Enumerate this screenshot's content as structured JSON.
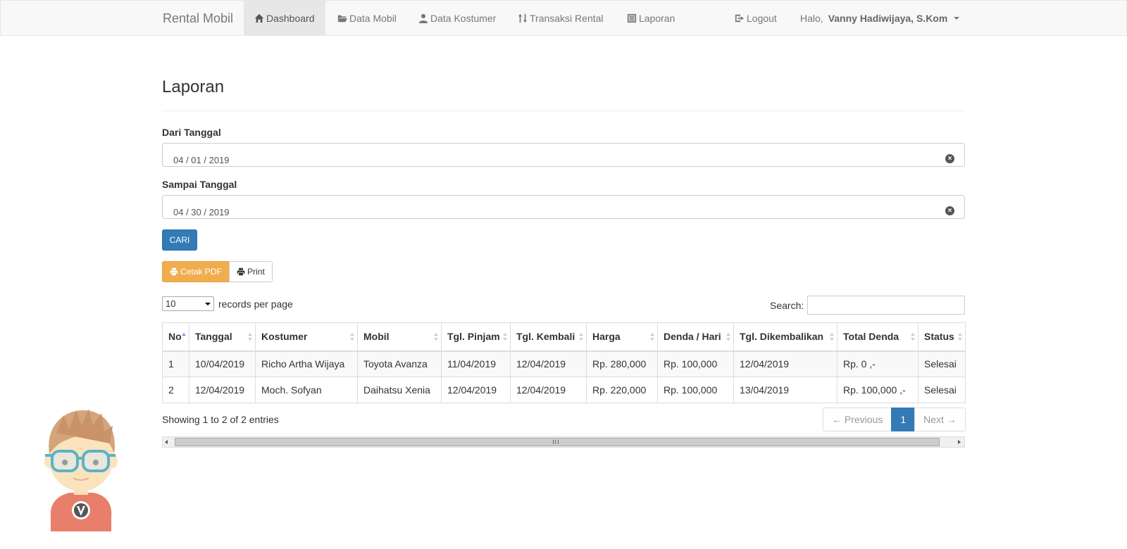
{
  "navbar": {
    "brand": "Rental Mobil",
    "items": [
      {
        "label": "Dashboard",
        "icon": "home-icon",
        "active": true
      },
      {
        "label": "Data Mobil",
        "icon": "folder-open-icon"
      },
      {
        "label": "Data Kostumer",
        "icon": "user-icon"
      },
      {
        "label": "Transaksi Rental",
        "icon": "sort-icon"
      },
      {
        "label": "Laporan",
        "icon": "list-alt-icon"
      }
    ],
    "logout": "Logout",
    "greeting": "Halo,",
    "user_name": "Vanny Hadiwijaya, S.Kom"
  },
  "page": {
    "title": "Laporan"
  },
  "form": {
    "from_label": "Dari Tanggal",
    "from_value": "04 / 01 / 2019",
    "to_label": "Sampai Tanggal",
    "to_value": "04 / 30 / 2019",
    "submit_label": "CARI"
  },
  "actions": {
    "pdf_label": "Cetak PDF",
    "print_label": "Print"
  },
  "table_controls": {
    "per_page_value": "10",
    "per_page_label": "records per page",
    "search_label": "Search:"
  },
  "table": {
    "headers": [
      "No",
      "Tanggal",
      "Kostumer",
      "Mobil",
      "Tgl. Pinjam",
      "Tgl. Kembali",
      "Harga",
      "Denda / Hari",
      "Tgl. Dikembalikan",
      "Total Denda",
      "Status"
    ],
    "rows": [
      [
        "1",
        "10/04/2019",
        "Richo Artha Wijaya",
        "Toyota Avanza",
        "11/04/2019",
        "12/04/2019",
        "Rp. 280,000",
        "Rp. 100,000",
        "12/04/2019",
        "Rp. 0 ,-",
        "Selesai"
      ],
      [
        "2",
        "12/04/2019",
        "Moch. Sofyan",
        "Daihatsu Xenia",
        "12/04/2019",
        "12/04/2019",
        "Rp. 220,000",
        "Rp. 100,000",
        "13/04/2019",
        "Rp. 100,000 ,-",
        "Selesai"
      ]
    ]
  },
  "footer": {
    "info": "Showing 1 to 2 of 2 entries",
    "prev": "← Previous",
    "page": "1",
    "next": "Next →"
  },
  "colors": {
    "primary": "#337ab7",
    "warning": "#f0ad4e"
  }
}
